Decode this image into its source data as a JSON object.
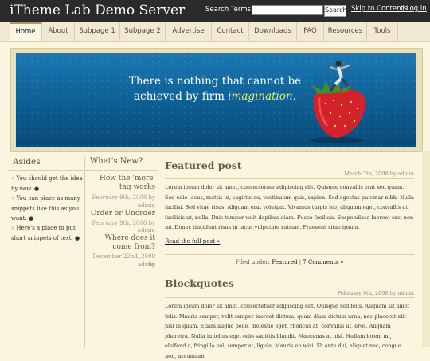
{
  "header": {
    "site_title": "iTheme Lab Demo Server",
    "search_label": "Search Terms:",
    "search_value": "",
    "search_button": "Search",
    "skip_link": "Skip to Contents",
    "separator": "|",
    "login_link": "Log in"
  },
  "nav": {
    "items": [
      {
        "label": "Home"
      },
      {
        "label": "About"
      },
      {
        "label": "Subpage 1"
      },
      {
        "label": "Subpage 2"
      },
      {
        "label": "Advertise"
      },
      {
        "label": "Contact"
      },
      {
        "label": "Downloads"
      },
      {
        "label": "FAQ"
      },
      {
        "label": "Resources"
      },
      {
        "label": "Tools"
      }
    ],
    "active": "Home"
  },
  "banner": {
    "line1": "There is nothing that cannot be",
    "line2_start": "achieved by firm ",
    "line2_accent": "imagination",
    "line2_end": "."
  },
  "asides": {
    "title": "Asides",
    "items": [
      {
        "text": "You should get the idea by now.",
        "icon": "comment-icon"
      },
      {
        "text": "You can place as many snippets like this as you want.",
        "icon": "comment-icon"
      },
      {
        "text": "Here's a place to put short snippets of text.",
        "icon": "comment-icon"
      }
    ]
  },
  "whats_new": {
    "title": "What's New?",
    "items": [
      {
        "title": "How the 'more' tag works",
        "date": "February 9th, 2008 by",
        "author": "admin"
      },
      {
        "title": "Order or Unorder",
        "date": "February 9th, 2008 by",
        "author": "admin"
      },
      {
        "title": "Where does it come from?",
        "date": "December 22nd, 2009 by",
        "author": "admin"
      }
    ]
  },
  "posts": [
    {
      "title": "Featured post",
      "meta": "March 7th, 2008 by admin",
      "body": "Lorem ipsum dolor sit amet, consectetuer adipiscing elit. Quisque convallis erat sed quam. Sed odio lacus, mattis in, sagittis eu, vestibulum quis, sapien. Sed egestas pulvinar nibh. Nulla facilisi. Sed vitae risus. Aliquam erat volutpat. Vivamus turpis leo, aliquam eget, convallis ut, facilisis ut, nulla. Duis tempor velit dapibus diam. Fusce facilisis. Suspendisse laoreet orci non mi. Donec tincidunt risus in lacus vulputate rutrum. Praesent vitae ipsum.",
      "read_more": "Read the full post »",
      "filed_label": "Filed under:",
      "category": "Featured",
      "comments": "7 Comments »"
    },
    {
      "title": "Blockquotes",
      "meta": "February 9th, 2008 by admin",
      "body": "Lorem ipsum dolor sit amet, consectetuer adipiscing elit. Quisque sed felis. Aliquam sit amet felis. Mauris semper, velit semper laoreet dictum, quam diam dictum urna, nec placerat elit nisl in quam. Etiam augue pede, molestie eget, rhoncus at, convallis ut, eros. Aliquam pharetra. Nulla in tellus eget odio sagittis blandit. Maecenas at nisl. Nullam lorem mi, eleifend a, fringilla vel, semper at, ligula. Mauris eu wisi. Ut ante dui, aliquet nec, congue non, accumsan"
    }
  ],
  "colors": {
    "header_bg": "#2b2b2b",
    "page_bg": "#fbf5df",
    "banner_blue": "#1b78b3",
    "accent_text": "#dff071",
    "title_brown": "#6b5a3f"
  }
}
